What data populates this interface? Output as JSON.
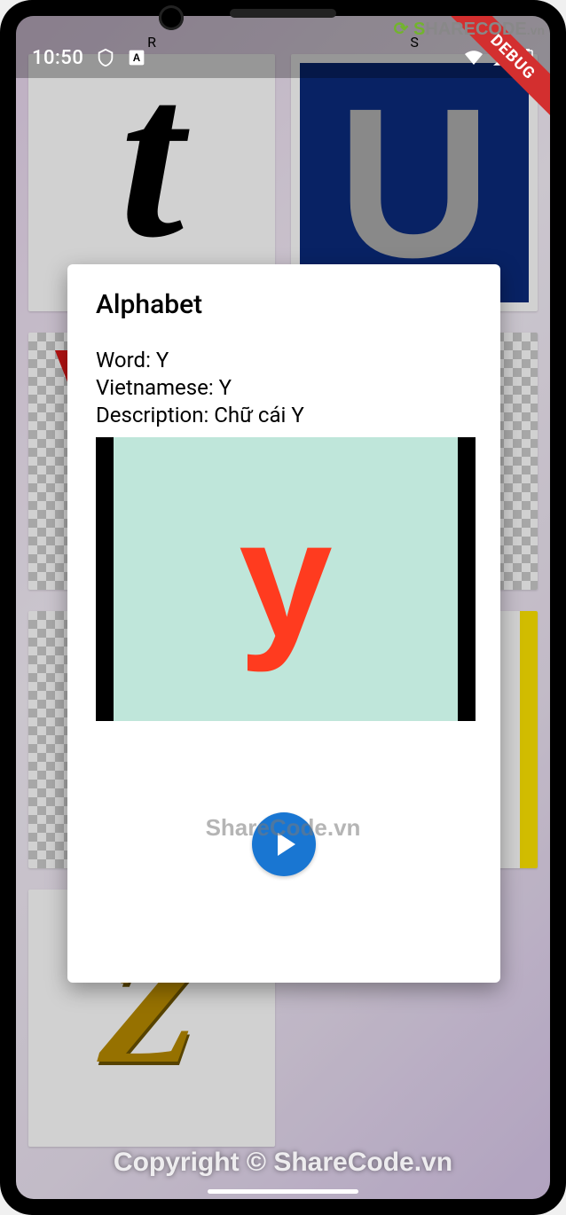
{
  "status": {
    "clock": "10:50",
    "icons": {
      "shield": "shield-outline",
      "translate": "translate",
      "wifi": "wifi",
      "signal": "cell-signal",
      "battery": "battery"
    }
  },
  "debug_badge": "DEBUG",
  "grid": {
    "row0": {
      "left_label": "R",
      "right_label": "S"
    },
    "tile_t_letter": "t",
    "tile_u_letter": "U",
    "tile_z_letter": "Z"
  },
  "dialog": {
    "title": "Alphabet",
    "word_label": "Word: ",
    "word_value": "Y",
    "viet_label": "Vietnamese: ",
    "viet_value": "Y",
    "desc_label": "Description: ",
    "desc_value": "Chữ cái Y",
    "video_letter": "y",
    "play_button": "Play"
  },
  "watermark": {
    "logo_text": "SHARECODE.vn",
    "center": "ShareCode.vn",
    "bottom": "Copyright © ShareCode.vn"
  }
}
